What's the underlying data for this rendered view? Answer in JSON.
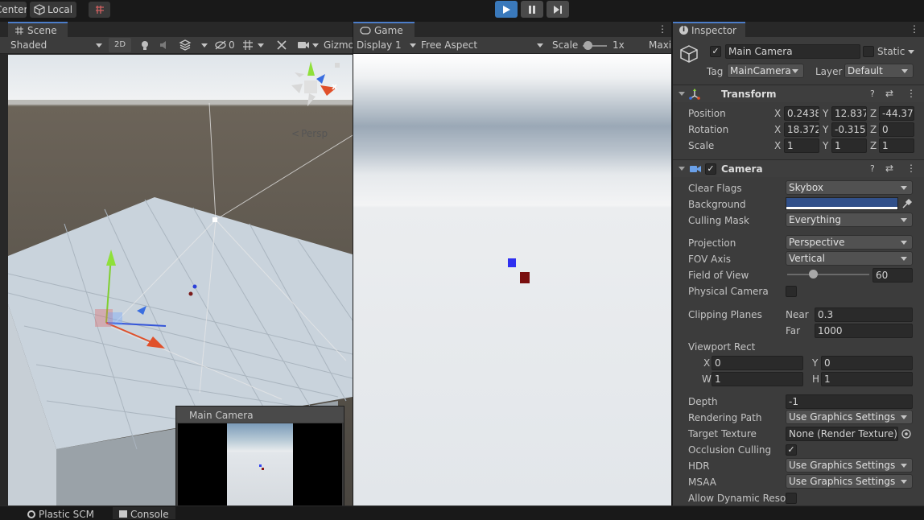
{
  "toolbar": {
    "pivot_center": "Center",
    "pivot_local": "Local",
    "play_icon": "play-icon",
    "pause_icon": "pause-icon",
    "step_icon": "step-icon"
  },
  "scene": {
    "tab_label": "Scene",
    "draw_mode": "Shaded",
    "btn_2d": "2D",
    "hidden_count": "0",
    "gizmos": "Gizmo",
    "persp_label": "Persp",
    "gizmo_x": "x",
    "preview_title": "Main Camera"
  },
  "game": {
    "tab_label": "Game",
    "display": "Display 1",
    "aspect": "Free Aspect",
    "scale_label": "Scale",
    "scale_value": "1x",
    "maximize": "Maxi"
  },
  "inspector": {
    "tab_label": "Inspector",
    "object_name": "Main Camera",
    "static_label": "Static",
    "tag_label": "Tag",
    "tag_value": "MainCamera",
    "layer_label": "Layer",
    "layer_value": "Default",
    "transform": {
      "title": "Transform",
      "rows": [
        {
          "label": "Position",
          "x": "0.2438",
          "y": "12.837",
          "z": "-44.37"
        },
        {
          "label": "Rotation",
          "x": "18.372",
          "y": "-0.315",
          "z": "0"
        },
        {
          "label": "Scale",
          "x": "1",
          "y": "1",
          "z": "1"
        }
      ],
      "axis_x": "X",
      "axis_y": "Y",
      "axis_z": "Z"
    },
    "camera": {
      "title": "Camera",
      "clear_flags_label": "Clear Flags",
      "clear_flags_value": "Skybox",
      "background_label": "Background",
      "background_color": "#31508a",
      "culling_mask_label": "Culling Mask",
      "culling_mask_value": "Everything",
      "projection_label": "Projection",
      "projection_value": "Perspective",
      "fov_axis_label": "FOV Axis",
      "fov_axis_value": "Vertical",
      "fov_label": "Field of View",
      "fov_value": "60",
      "fov_slider_fraction": 0.33,
      "physical_camera_label": "Physical Camera",
      "clipping_planes_label": "Clipping Planes",
      "near_label": "Near",
      "near_value": "0.3",
      "far_label": "Far",
      "far_value": "1000",
      "viewport_rect_label": "Viewport Rect",
      "vp_x_label": "X",
      "vp_x": "0",
      "vp_y_label": "Y",
      "vp_y": "0",
      "vp_w_label": "W",
      "vp_w": "1",
      "vp_h_label": "H",
      "vp_h": "1",
      "depth_label": "Depth",
      "depth_value": "-1",
      "rendering_path_label": "Rendering Path",
      "rendering_path_value": "Use Graphics Settings",
      "target_texture_label": "Target Texture",
      "target_texture_value": "None (Render Texture)",
      "occlusion_label": "Occlusion Culling",
      "hdr_label": "HDR",
      "hdr_value": "Use Graphics Settings",
      "msaa_label": "MSAA",
      "msaa_value": "Use Graphics Settings",
      "dynamic_res_label": "Allow Dynamic Resol"
    }
  },
  "bottom": {
    "plastic_label": "Plastic SCM",
    "console_label": "Console"
  },
  "colors": {
    "accent": "#3a79bb",
    "panel": "#383838",
    "inspector_bg": "#3c3c3c"
  }
}
